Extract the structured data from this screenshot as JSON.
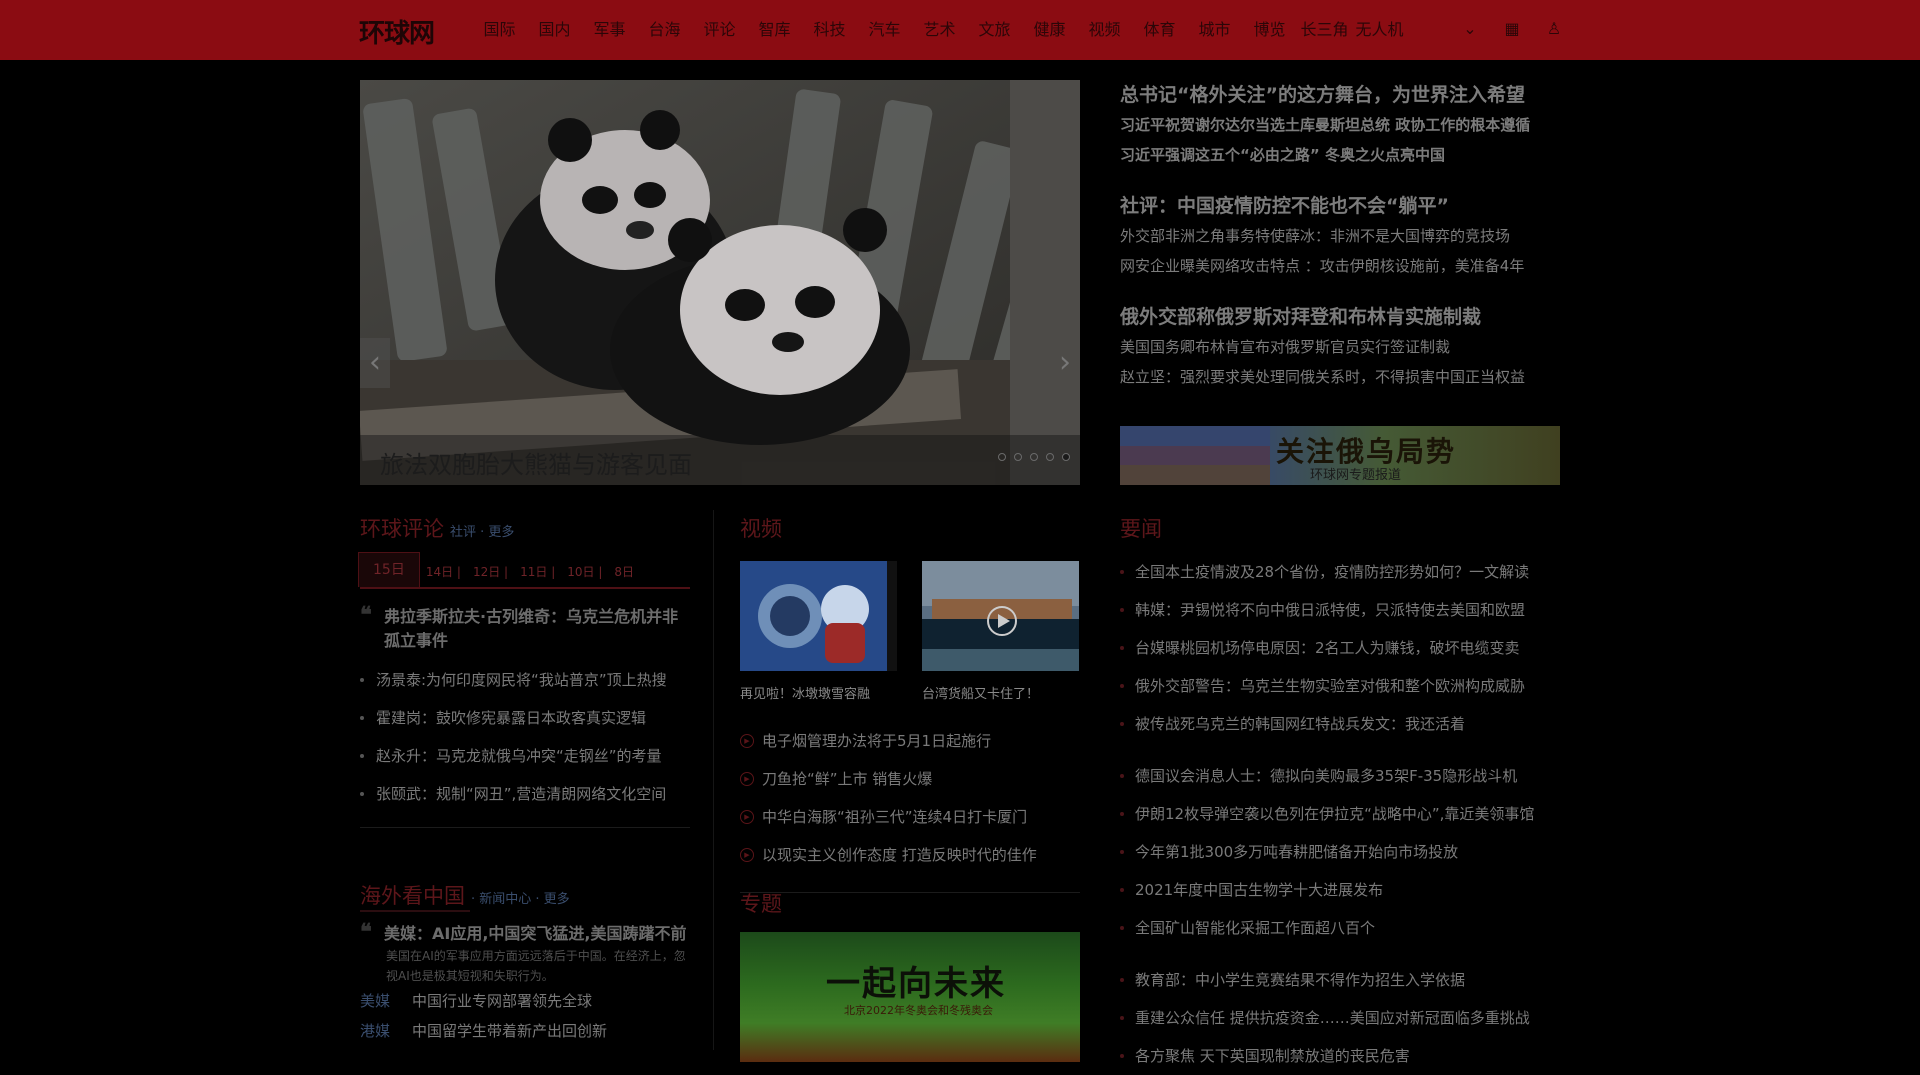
{
  "nav": {
    "logo": "环球网",
    "items": [
      "国际",
      "国内",
      "军事",
      "台海",
      "评论",
      "智库",
      "科技",
      "汽车",
      "艺术",
      "文旅",
      "健康",
      "视频",
      "体育",
      "城市",
      "博览",
      "长三角",
      "无人机"
    ]
  },
  "hero": {
    "caption": "旅法双胞胎大熊猫与游客见面",
    "dots": 5,
    "active_dot": 4
  },
  "headlines": [
    {
      "main": "总书记“格外关注”的这方舞台，为世界注入希望",
      "subs": [
        "习近平祝贺谢尔达尔当选土库曼斯坦总统 政协工作的根本遵循",
        "习近平强调这五个“必由之路” 冬奥之火点亮中国"
      ],
      "subs_bold": true
    },
    {
      "main": "社评：中国疫情防控不能也不会“躺平”",
      "subs": [
        "外交部非洲之角事务特使薛冰：非洲不是大国博弈的竞技场",
        "网安企业曝美网络攻击特点 ：攻击伊朗核设施前，美准备4年"
      ],
      "subs_bold": false
    },
    {
      "main": "俄外交部称俄罗斯对拜登和布林肯实施制裁",
      "subs": [
        "美国国务卿布林肯宣布对俄罗斯官员实行签证制裁",
        "赵立坚：强烈要求美处理同俄关系时，不得损害中国正当权益"
      ],
      "subs_bold": false
    }
  ],
  "banner": {
    "title": "关注俄乌局势",
    "subtitle": "环球网专题报道"
  },
  "commentary": {
    "title": "环球评论",
    "links": "社评 · 更多",
    "date_tabs": [
      "15日",
      "14日 |",
      "12日 |",
      "11日 |",
      "10日 |",
      "8日"
    ],
    "featured": "弗拉季斯拉夫·古列维奇：乌克兰危机并非孤立事件",
    "items": [
      "汤景泰:为何印度网民将“我站普京”顶上热搜",
      "霍建岗：鼓吹修宪暴露日本政客真实逻辑",
      "赵永升：马克龙就俄乌冲突“走钢丝”的考量",
      "张颐武：规制“网丑”,营造清朗网络文化空间"
    ]
  },
  "overseas": {
    "title": "海外看中国",
    "links": "· 新闻中心 · 更多",
    "featured": "美媒：AI应用,中国突飞猛进,美国踌躇不前",
    "summary": "美国在AI的军事应用方面远远落后于中国。在经济上，忽视AI也是极其短视和失职行为。",
    "rows": [
      {
        "tag": "美媒",
        "text": "中国行业专网部署领先全球"
      },
      {
        "tag": "港媒",
        "text": "中国留学生带着新产出回创新"
      }
    ]
  },
  "video": {
    "title": "视频",
    "cards": [
      {
        "caption": "再见啦！冰墩墩雪容融"
      },
      {
        "caption": "台湾货船又卡住了！"
      }
    ],
    "items": [
      "电子烟管理办法将于5月1日起施行",
      "刀鱼抢“鲜”上市 销售火爆",
      "中华白海豚“祖孙三代”连续4日打卡厦门",
      "以现实主义创作态度 打造反映时代的佳作"
    ]
  },
  "special": {
    "title": "专题",
    "banner_title": "一起向未来",
    "banner_sub": "北京2022年冬奥会和冬残奥会"
  },
  "news": {
    "title": "要闻",
    "group1": [
      "全国本土疫情波及28个省份，疫情防控形势如何？一文解读",
      "韩媒：尹锡悦将不向中俄日派特使，只派特使去美国和欧盟",
      "台媒曝桃园机场停电原因：2名工人为赚钱，破坏电缆变卖",
      "俄外交部警告：乌克兰生物实验室对俄和整个欧洲构成威胁",
      "被传战死乌克兰的韩国网红特战兵发文：我还活着"
    ],
    "group2": [
      "德国议会消息人士：德拟向美购最多35架F-35隐形战斗机",
      "伊朗12枚导弹空袭以色列在伊拉克“战略中心”,靠近美领事馆",
      "今年第1批300多万吨春耕肥储备开始向市场投放",
      "2021年度中国古生物学十大进展发布",
      "全国矿山智能化采掘工作面超八百个"
    ],
    "group3": [
      "教育部：中小学生竞赛结果不得作为招生入学依据",
      "重建公众信任 提供抗疫资金……美国应对新冠面临多重挑战",
      "各方聚焦 天下英国现制禁放道的丧民危害"
    ]
  }
}
